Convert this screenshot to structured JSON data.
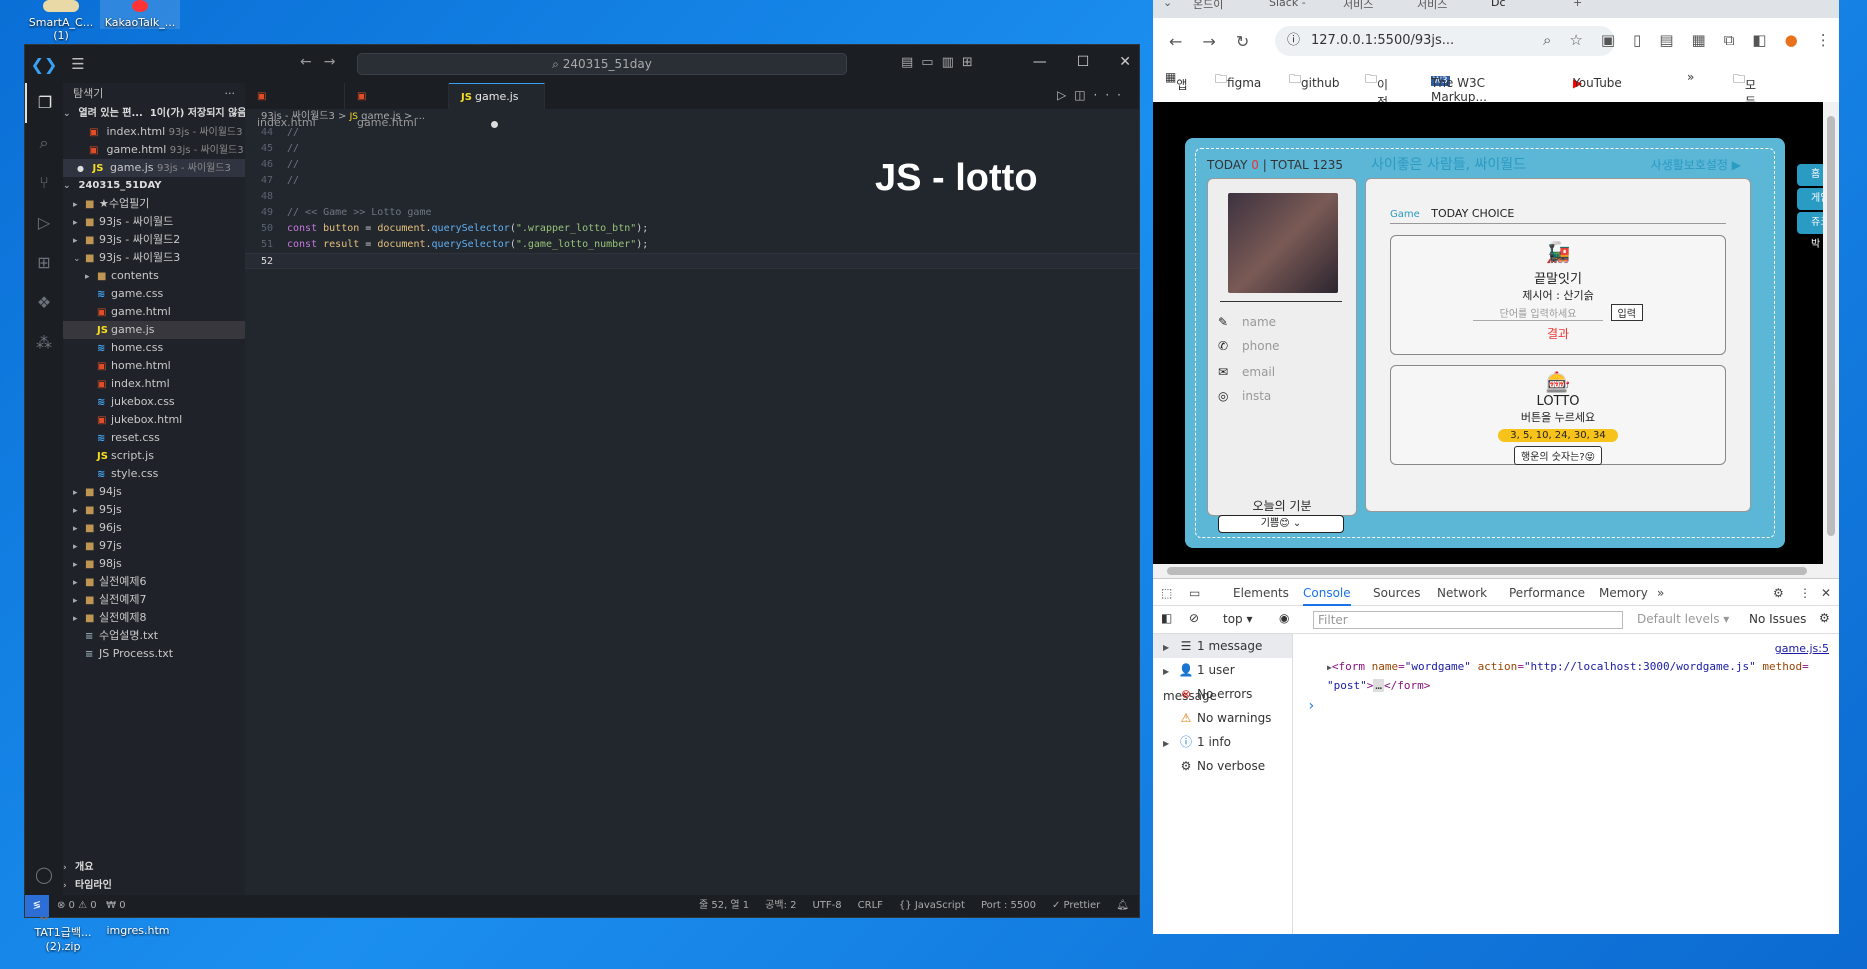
{
  "desktop": {
    "icons": [
      {
        "label": "SmartA_C...",
        "sub": "(1)"
      },
      {
        "label": "KakaoTalk_..."
      },
      {
        "label": "TAT1급백...",
        "sub": "(2).zip"
      },
      {
        "label": "imgres.htm"
      }
    ]
  },
  "vscode": {
    "search": "240315_51day",
    "sidebar": {
      "title": "탐색기",
      "open_editors": "열려 있는 편...",
      "unsaved": "1이(가) 저장되지 않음",
      "open_files": [
        {
          "name": "index.html",
          "path": "93js - 싸이월드3"
        },
        {
          "name": "game.html",
          "path": "93js - 싸이월드3"
        },
        {
          "name": "game.js",
          "path": "93js - 싸이월드3"
        }
      ],
      "root": "240315_51DAY",
      "tree": [
        {
          "name": "★수업필기",
          "type": "folder",
          "depth": 1
        },
        {
          "name": "93js - 싸이월드",
          "type": "folder",
          "depth": 1
        },
        {
          "name": "93js - 싸이월드2",
          "type": "folder",
          "depth": 1
        },
        {
          "name": "93js - 싸이월드3",
          "type": "folder-open",
          "depth": 1
        },
        {
          "name": "contents",
          "type": "folder",
          "depth": 2
        },
        {
          "name": "game.css",
          "type": "css",
          "depth": 2
        },
        {
          "name": "game.html",
          "type": "html",
          "depth": 2
        },
        {
          "name": "game.js",
          "type": "js",
          "depth": 2
        },
        {
          "name": "home.css",
          "type": "css",
          "depth": 2
        },
        {
          "name": "home.html",
          "type": "html",
          "depth": 2
        },
        {
          "name": "index.html",
          "type": "html",
          "depth": 2
        },
        {
          "name": "jukebox.css",
          "type": "css",
          "depth": 2
        },
        {
          "name": "jukebox.html",
          "type": "html",
          "depth": 2
        },
        {
          "name": "reset.css",
          "type": "css",
          "depth": 2
        },
        {
          "name": "script.js",
          "type": "js",
          "depth": 2
        },
        {
          "name": "style.css",
          "type": "css",
          "depth": 2
        },
        {
          "name": "94js",
          "type": "folder",
          "depth": 1
        },
        {
          "name": "95js",
          "type": "folder",
          "depth": 1
        },
        {
          "name": "96js",
          "type": "folder",
          "depth": 1
        },
        {
          "name": "97js",
          "type": "folder",
          "depth": 1
        },
        {
          "name": "98js",
          "type": "folder",
          "depth": 1
        },
        {
          "name": "실전예제6",
          "type": "folder",
          "depth": 1
        },
        {
          "name": "실전예제7",
          "type": "folder",
          "depth": 1
        },
        {
          "name": "실전예제8",
          "type": "folder",
          "depth": 1
        },
        {
          "name": "수업설명.txt",
          "type": "txt",
          "depth": 1
        },
        {
          "name": "JS Process.txt",
          "type": "txt",
          "depth": 1
        }
      ],
      "outline": "개요",
      "timeline": "타임라인"
    },
    "tabs": [
      {
        "label": "index.html"
      },
      {
        "label": "game.html"
      },
      {
        "label": "game.js"
      }
    ],
    "breadcrumb": {
      "folder": "93js - 싸이월드3",
      "sep": ">",
      "file": "game.js",
      "tail": "..."
    },
    "overlay_title": "JS - lotto",
    "code_lines": [
      {
        "n": "44",
        "text": "//"
      },
      {
        "n": "45",
        "text": "//"
      },
      {
        "n": "46",
        "text": "//"
      },
      {
        "n": "47",
        "text": "//"
      },
      {
        "n": "48",
        "text": ""
      },
      {
        "n": "49",
        "text": "//  << Game >> Lotto game"
      },
      {
        "n": "50",
        "text": "const button = document.querySelector(\".wrapper_lotto_btn\");"
      },
      {
        "n": "51",
        "text": "const result = document.querySelector(\".game_lotto_number\");"
      },
      {
        "n": "52",
        "text": ""
      }
    ],
    "status": {
      "problems": "⊗ 0 ⚠ 0",
      "ports": "₩ 0",
      "position": "줄 52, 열 1",
      "spaces": "공백: 2",
      "encoding": "UTF-8",
      "eol": "CRLF",
      "language": "JavaScript",
      "port": "Port : 5500",
      "prettier": "✓ Prettier"
    }
  },
  "chrome": {
    "tabs": [
      "온드이",
      "Slack -",
      "서비스",
      "서비스",
      "Dc"
    ],
    "url": "127.0.0.1:5500/93js...",
    "bookmarks": [
      "앱",
      "figma",
      "github",
      "이전",
      "The W3C Markup...",
      "YouTube",
      "모든 북마크"
    ],
    "page": {
      "today_label": "TODAY",
      "today_value": "0",
      "total_label": "| TOTAL 1235",
      "title": "사이좋은 사람들, 싸이월드",
      "privacy": "사생활보호설정 ▶",
      "profile": {
        "fields": [
          {
            "icon": "✎",
            "label": "name"
          },
          {
            "icon": "✆",
            "label": "phone"
          },
          {
            "icon": "✉",
            "label": "email"
          },
          {
            "icon": "◎",
            "label": "insta"
          }
        ],
        "mood_label": "오늘의 기분",
        "mood_value": "기쁨😊"
      },
      "game_tag": "Game",
      "game_header": "TODAY CHOICE",
      "word_game": {
        "emoji": "🚂",
        "title": "끝말잇기",
        "subtitle": "제시어 : 산기슭",
        "placeholder": "단어를 입력하세요",
        "button": "입력",
        "result": "결과"
      },
      "lotto": {
        "emoji": "🎰",
        "title": "LOTTO",
        "subtitle": "버튼을 누르세요",
        "numbers": "3, 5, 10, 24, 30, 34",
        "button": "행운의 숫자는?😝"
      },
      "side_nav": [
        "홈",
        "게임",
        "쥬크박"
      ]
    },
    "devtools": {
      "tabs": [
        "Elements",
        "Console",
        "Sources",
        "Network",
        "Performance",
        "Memory"
      ],
      "context": "top",
      "filter_placeholder": "Filter",
      "levels": "Default levels",
      "issues": "No Issues",
      "sidebar": [
        {
          "label": "1 message",
          "icon": "☰",
          "arrow": true
        },
        {
          "label": "1 user message",
          "icon": "👤",
          "arrow": true
        },
        {
          "label": "No errors",
          "icon": "⊗",
          "arrow": false
        },
        {
          "label": "No warnings",
          "icon": "⚠",
          "arrow": false
        },
        {
          "label": "1 info",
          "icon": "ⓘ",
          "arrow": true
        },
        {
          "label": "No verbose",
          "icon": "⚙",
          "arrow": false
        }
      ],
      "source_link": "game.js:5",
      "log": {
        "tag_open": "<form",
        "attr1": "name",
        "val1": "\"wordgame\"",
        "attr2": "action",
        "val2": "\"http://localhost:3000/wordgame.js\"",
        "attr3": "method",
        "val3": "\"post\"",
        "ellipsis": "…",
        "tag_close": "</form>"
      }
    }
  }
}
